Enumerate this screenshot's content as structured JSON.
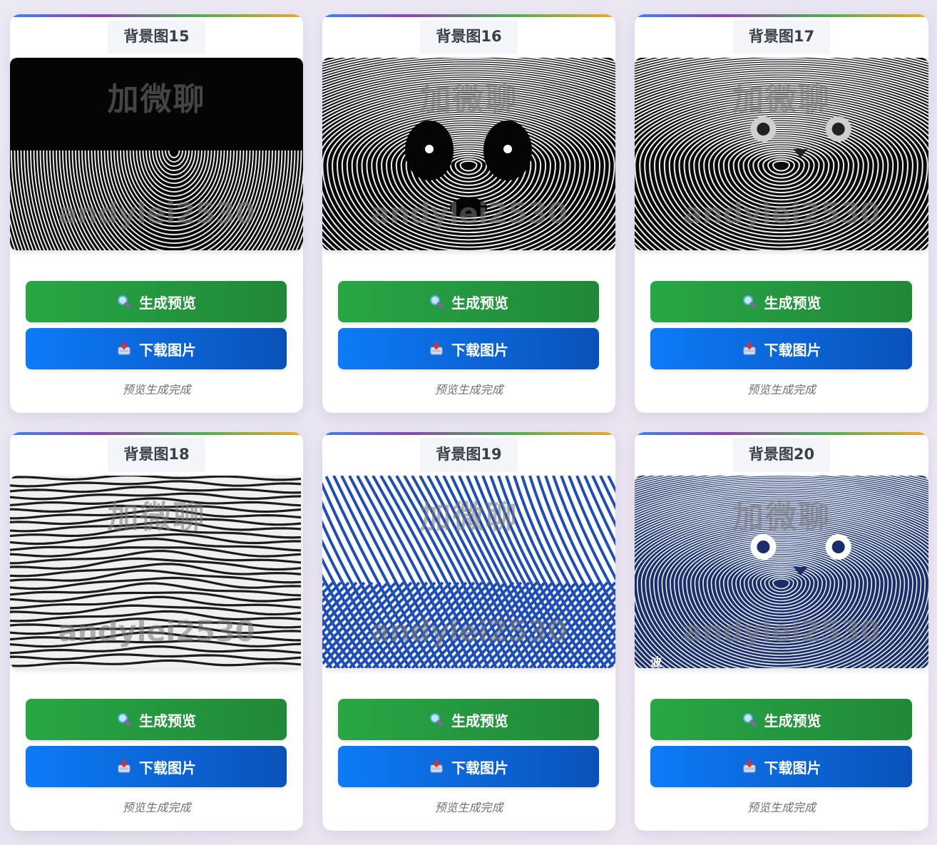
{
  "cards": [
    {
      "title": "背景图15",
      "watermark_top": "加微聊",
      "watermark_bottom": "andylei2530",
      "preview_label": "生成预览",
      "download_label": "下载图片",
      "status": "预览生成完成",
      "scene": "body",
      "palette": {
        "bg": "#050505",
        "line": "#e8e8e8"
      }
    },
    {
      "title": "背景图16",
      "watermark_top": "加微聊",
      "watermark_bottom": "andylei2530",
      "preview_label": "生成预览",
      "download_label": "下载图片",
      "status": "预览生成完成",
      "scene": "panda",
      "palette": {
        "bg": "#050505",
        "line": "#f0f0f0"
      }
    },
    {
      "title": "背景图17",
      "watermark_top": "加微聊",
      "watermark_bottom": "andylei2530",
      "preview_label": "生成预览",
      "download_label": "下载图片",
      "status": "预览生成完成",
      "scene": "cat",
      "palette": {
        "bg": "#0a0a0a",
        "line": "#f2f2f2"
      }
    },
    {
      "title": "背景图18",
      "watermark_top": "加微聊",
      "watermark_bottom": "andylei2530",
      "preview_label": "生成预览",
      "download_label": "下载图片",
      "status": "预览生成完成",
      "scene": "rabbit",
      "palette": {
        "bg": "#f0f0f0",
        "line": "#1c1c1c"
      }
    },
    {
      "title": "背景图19",
      "watermark_top": "加微聊",
      "watermark_bottom": "andylei2530",
      "preview_label": "生成预览",
      "download_label": "下载图片",
      "status": "预览生成完成",
      "scene": "diagonal",
      "palette": {
        "bg": "#ffffff",
        "line": "#1f4fb6"
      }
    },
    {
      "title": "背景图20",
      "watermark_top": "加微聊",
      "watermark_bottom": "andylei2530",
      "preview_label": "生成预览",
      "download_label": "下载图片",
      "status": "预览生成完成",
      "scene": "cat2",
      "palette": {
        "bg": "#1a2e6b",
        "line": "#e9eef8"
      },
      "corner_text": "波"
    }
  ],
  "icons": {
    "preview": "magnifier-icon",
    "download": "inbox-tray-icon"
  },
  "colors": {
    "preview_btn": "#28a745",
    "download_btn": "#0d7bf7",
    "accent_bar": [
      "#3b82f6",
      "#8e44ad",
      "#4caf50",
      "#f5a623"
    ]
  }
}
